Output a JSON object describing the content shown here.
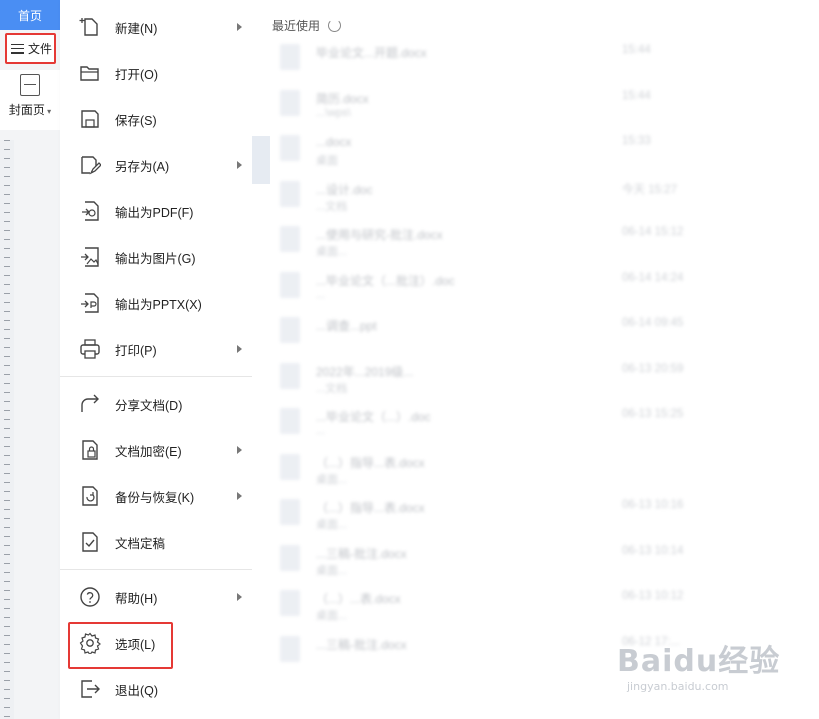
{
  "app": {
    "home_tab": "首页",
    "file_button": "文件",
    "cover_page_label": "封面页"
  },
  "file_menu": {
    "items": [
      {
        "label": "新建(N)",
        "icon": "new-file-icon",
        "submenu": true
      },
      {
        "label": "打开(O)",
        "icon": "folder-open-icon",
        "submenu": false
      },
      {
        "label": "保存(S)",
        "icon": "save-icon",
        "submenu": false
      },
      {
        "label": "另存为(A)",
        "icon": "save-as-icon",
        "submenu": true
      },
      {
        "label": "输出为PDF(F)",
        "icon": "export-pdf-icon",
        "submenu": false
      },
      {
        "label": "输出为图片(G)",
        "icon": "export-image-icon",
        "submenu": false
      },
      {
        "label": "输出为PPTX(X)",
        "icon": "export-pptx-icon",
        "submenu": false
      },
      {
        "label": "打印(P)",
        "icon": "printer-icon",
        "submenu": true
      },
      {
        "label": "分享文档(D)",
        "icon": "share-icon",
        "submenu": false
      },
      {
        "label": "文档加密(E)",
        "icon": "encrypt-icon",
        "submenu": true
      },
      {
        "label": "备份与恢复(K)",
        "icon": "backup-icon",
        "submenu": true
      },
      {
        "label": "文档定稿",
        "icon": "finalize-icon",
        "submenu": false
      },
      {
        "label": "帮助(H)",
        "icon": "help-icon",
        "submenu": true
      },
      {
        "label": "选项(L)",
        "icon": "gear-icon",
        "submenu": false
      },
      {
        "label": "退出(Q)",
        "icon": "exit-icon",
        "submenu": false
      }
    ]
  },
  "recent": {
    "title": "最近使用",
    "files": [
      {
        "name": "毕业论文...开题.docx",
        "sub": "",
        "time": "15:44"
      },
      {
        "name": "简历.docx",
        "sub": "...\\wps\\",
        "time": "15:44"
      },
      {
        "name": "...docx",
        "sub": "桌面",
        "time": "15:33"
      },
      {
        "name": "...设计.doc",
        "sub": "...文档",
        "time": "今天 15:27"
      },
      {
        "name": "...使用与研究-批注.docx",
        "sub": "桌面...",
        "time": "06-14 15:12"
      },
      {
        "name": "...毕业论文（...批注）.doc",
        "sub": "...",
        "time": "06-14 14:24"
      },
      {
        "name": "...调查...ppt",
        "sub": "",
        "time": "06-14 09:45"
      },
      {
        "name": "2022年...2019级...",
        "sub": "...文档",
        "time": "06-13 20:59"
      },
      {
        "name": "...毕业论文（...）.doc",
        "sub": "...",
        "time": "06-13 15:25"
      },
      {
        "name": "（...）指导...表.docx",
        "sub": "桌面...",
        "time": ""
      },
      {
        "name": "（...）指导...表.docx",
        "sub": "桌面...",
        "time": "06-13 10:16"
      },
      {
        "name": "...三稿-批注.docx",
        "sub": "桌面...",
        "time": "06-13 10:14"
      },
      {
        "name": "（...）...表.docx",
        "sub": "桌面...",
        "time": "06-13 10:12"
      },
      {
        "name": "...三稿-批注.docx",
        "sub": "",
        "time": "06-12 17:..."
      }
    ]
  },
  "watermark": {
    "main": "Baidu经验",
    "sub": "jingyan.baidu.com"
  }
}
